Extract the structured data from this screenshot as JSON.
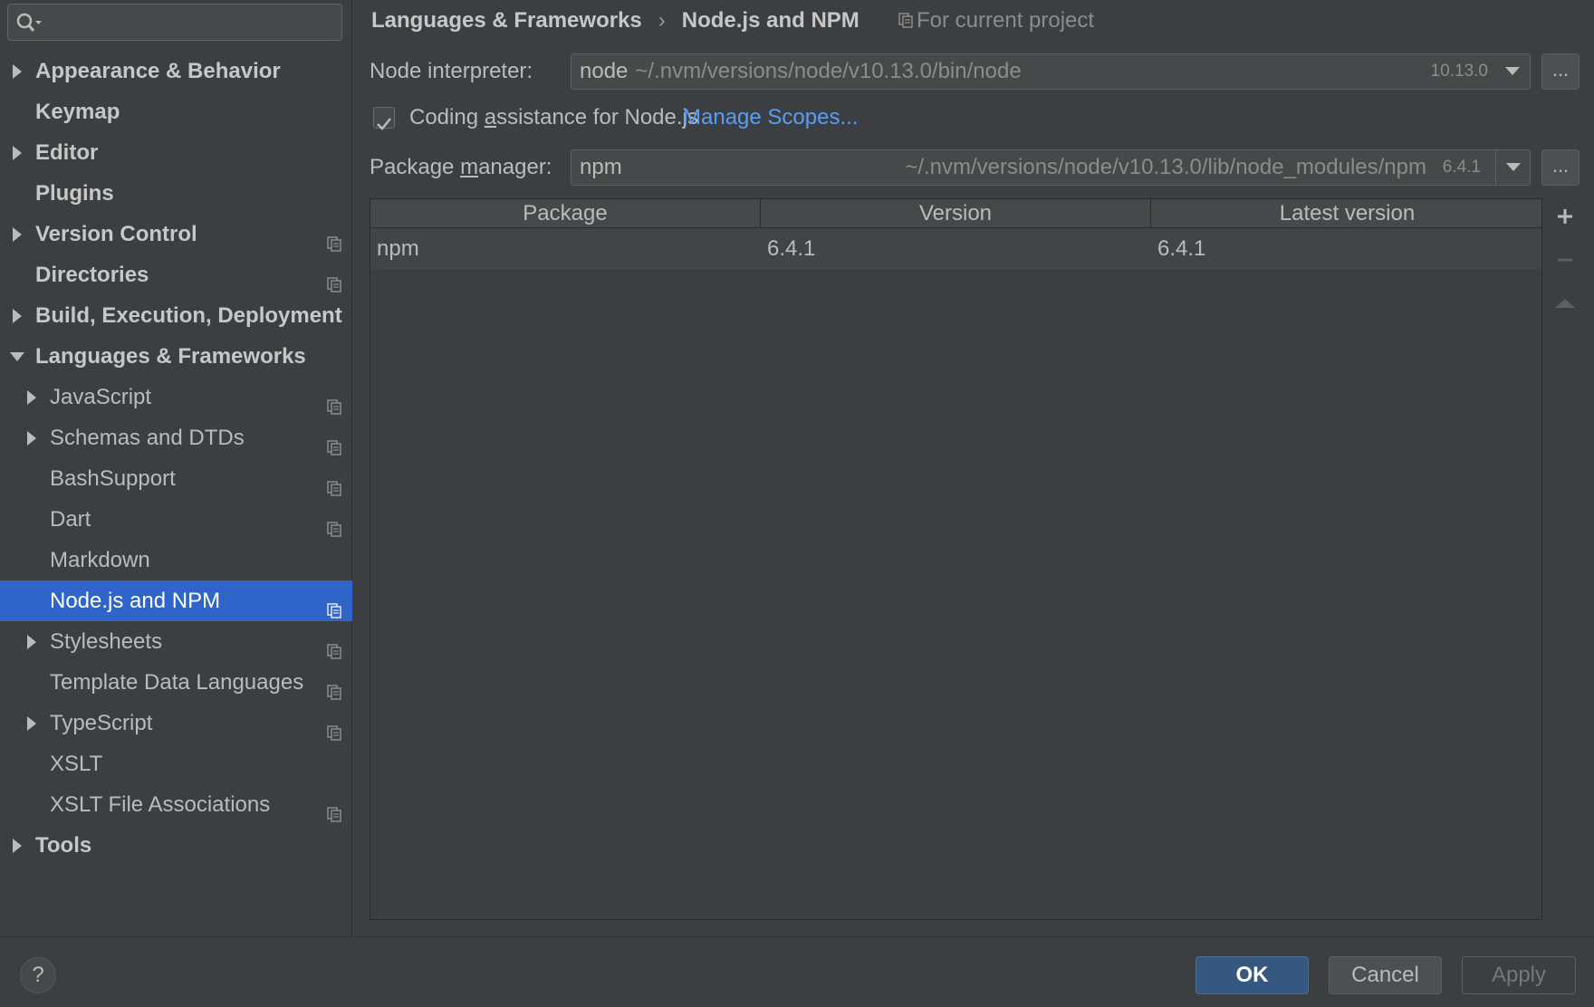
{
  "search": {
    "placeholder": ""
  },
  "sidebar": {
    "items": [
      {
        "label": "Appearance & Behavior",
        "bold": true,
        "arrow": "right",
        "level": 0,
        "project": false
      },
      {
        "label": "Keymap",
        "bold": true,
        "arrow": "none",
        "level": 0,
        "project": false
      },
      {
        "label": "Editor",
        "bold": true,
        "arrow": "right",
        "level": 0,
        "project": false
      },
      {
        "label": "Plugins",
        "bold": true,
        "arrow": "none",
        "level": 0,
        "project": false
      },
      {
        "label": "Version Control",
        "bold": true,
        "arrow": "right",
        "level": 0,
        "project": true
      },
      {
        "label": "Directories",
        "bold": true,
        "arrow": "none",
        "level": 0,
        "project": true
      },
      {
        "label": "Build, Execution, Deployment",
        "bold": true,
        "arrow": "right",
        "level": 0,
        "project": false
      },
      {
        "label": "Languages & Frameworks",
        "bold": true,
        "arrow": "down",
        "level": 0,
        "project": false
      },
      {
        "label": "JavaScript",
        "bold": false,
        "arrow": "right",
        "level": 1,
        "project": true
      },
      {
        "label": "Schemas and DTDs",
        "bold": false,
        "arrow": "right",
        "level": 1,
        "project": true
      },
      {
        "label": "BashSupport",
        "bold": false,
        "arrow": "none",
        "level": 1,
        "project": true
      },
      {
        "label": "Dart",
        "bold": false,
        "arrow": "none",
        "level": 1,
        "project": true
      },
      {
        "label": "Markdown",
        "bold": false,
        "arrow": "none",
        "level": 1,
        "project": false
      },
      {
        "label": "Node.js and NPM",
        "bold": false,
        "arrow": "none",
        "level": 1,
        "project": true,
        "selected": true
      },
      {
        "label": "Stylesheets",
        "bold": false,
        "arrow": "right",
        "level": 1,
        "project": true
      },
      {
        "label": "Template Data Languages",
        "bold": false,
        "arrow": "none",
        "level": 1,
        "project": true
      },
      {
        "label": "TypeScript",
        "bold": false,
        "arrow": "right",
        "level": 1,
        "project": true
      },
      {
        "label": "XSLT",
        "bold": false,
        "arrow": "none",
        "level": 1,
        "project": false
      },
      {
        "label": "XSLT File Associations",
        "bold": false,
        "arrow": "none",
        "level": 1,
        "project": true
      },
      {
        "label": "Tools",
        "bold": true,
        "arrow": "right",
        "level": 0,
        "project": false
      }
    ]
  },
  "breadcrumb": {
    "parent": "Languages & Frameworks",
    "separator": "›",
    "current": "Node.js and NPM",
    "scope": "For current project"
  },
  "node_interpreter": {
    "label": "Node interpreter:",
    "name": "node",
    "path": "~/.nvm/versions/node/v10.13.0/bin/node",
    "version": "10.13.0",
    "browse": "..."
  },
  "coding_assistance": {
    "checked": true,
    "label_pre": "Coding ",
    "label_mnemonic": "a",
    "label_post": "ssistance for Node.js",
    "link": "Manage Scopes..."
  },
  "package_manager": {
    "label_pre": "Package ",
    "label_mnemonic": "m",
    "label_post": "anager:",
    "name": "npm",
    "path": "~/.nvm/versions/node/v10.13.0/lib/node_modules/npm",
    "version": "6.4.1",
    "browse": "..."
  },
  "table": {
    "columns": [
      "Package",
      "Version",
      "Latest version"
    ],
    "rows": [
      [
        "npm",
        "6.4.1",
        "6.4.1"
      ]
    ]
  },
  "footer": {
    "help": "?",
    "ok": "OK",
    "cancel": "Cancel",
    "apply": "Apply"
  },
  "colors": {
    "background": "#3c3f41",
    "selection": "#2f65ca",
    "link": "#589df6",
    "ok_button": "#365880"
  }
}
